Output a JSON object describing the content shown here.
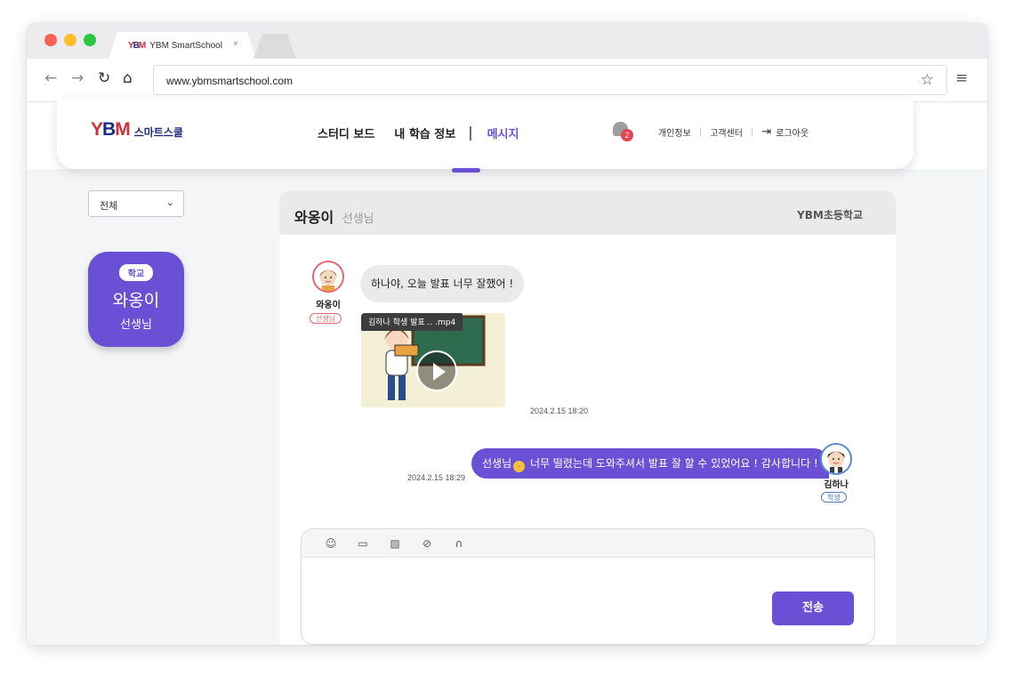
{
  "browser": {
    "tab_title": "YBM SmartSchool",
    "tab_close": "×",
    "url": "www.ybmsmartschool.com"
  },
  "header": {
    "brand_text": "스마트스쿨",
    "nav": [
      {
        "label": "스터디 보드"
      },
      {
        "label": "내 학습 정보"
      },
      {
        "label": "메시지",
        "active": true
      }
    ],
    "nav_separator": "|",
    "notification_count": "2",
    "utils": [
      "개인정보",
      "고객센터",
      "로그아웃"
    ],
    "util_separator": "|"
  },
  "sidebar": {
    "filter": {
      "selected": "전체"
    },
    "contact": {
      "tag": "학교",
      "name": "와옹이",
      "role": "선생님"
    }
  },
  "chat": {
    "header": {
      "name": "와옹이",
      "title": "선생님",
      "school": "YBM초등학교"
    },
    "messages": [
      {
        "sender": "와옹이",
        "role": "선생님",
        "text": "하나야, 오늘 발표 너무 잘했어 !",
        "attachment": {
          "label": "김하나 학생 발표 ..  .mp4"
        },
        "timestamp": "2024.2.15 18:20"
      },
      {
        "sender": "김하나",
        "role": "학생",
        "text_before": "선생님",
        "emoji": "😅",
        "text_after": " 너무 떨렸는데 도와주셔서 발표 잘 할 수 있었어요 ! 감사합니다 !",
        "timestamp": "2024.2.15 18:29"
      }
    ],
    "composer": {
      "tools": [
        "emoji-icon",
        "video-icon",
        "image-icon",
        "attach-icon",
        "headphones-icon"
      ],
      "send_label": "전송"
    }
  },
  "colors": {
    "accent": "#6a50d5",
    "teacher": "#e5676d",
    "student": "#4a78c8",
    "badge": "#e8424f"
  }
}
